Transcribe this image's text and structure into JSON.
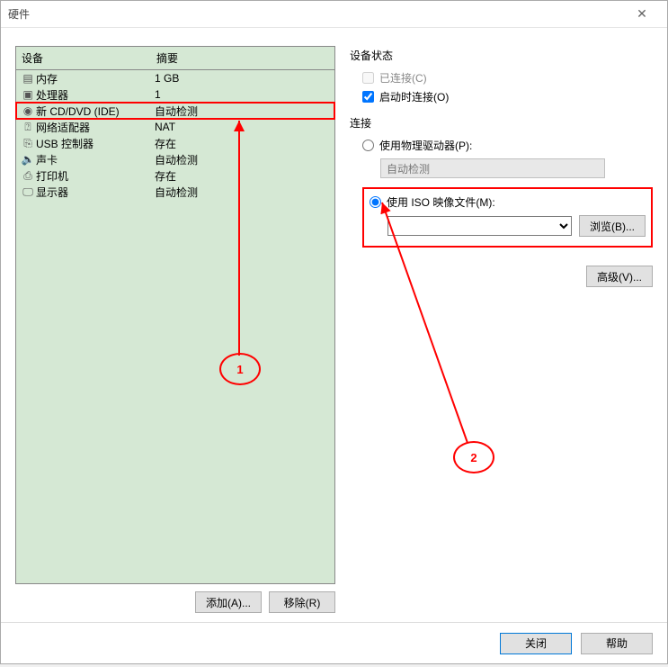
{
  "window": {
    "title": "硬件"
  },
  "left": {
    "headers": {
      "device": "设备",
      "summary": "摘要"
    },
    "rows": [
      {
        "icon": "memory-icon",
        "name": "内存",
        "summary": "1 GB"
      },
      {
        "icon": "cpu-icon",
        "name": "处理器",
        "summary": "1"
      },
      {
        "icon": "disc-icon",
        "name": "新 CD/DVD (IDE)",
        "summary": "自动检测",
        "selected": true
      },
      {
        "icon": "network-icon",
        "name": "网络适配器",
        "summary": "NAT"
      },
      {
        "icon": "usb-icon",
        "name": "USB 控制器",
        "summary": "存在"
      },
      {
        "icon": "sound-icon",
        "name": "声卡",
        "summary": "自动检测"
      },
      {
        "icon": "printer-icon",
        "name": "打印机",
        "summary": "存在"
      },
      {
        "icon": "display-icon",
        "name": "显示器",
        "summary": "自动检测"
      }
    ],
    "buttons": {
      "add": "添加(A)...",
      "remove": "移除(R)"
    }
  },
  "right": {
    "status": {
      "title": "设备状态",
      "connected": "已连接(C)",
      "connect_on_start": "启动时连接(O)"
    },
    "connection": {
      "title": "连接",
      "use_physical": "使用物理驱动器(P):",
      "auto_detect": "自动检测",
      "use_iso": "使用 ISO 映像文件(M):",
      "browse": "浏览(B)..."
    },
    "advanced": "高级(V)..."
  },
  "footer": {
    "close": "关闭",
    "help": "帮助"
  },
  "annotations": {
    "one": "1",
    "two": "2"
  }
}
